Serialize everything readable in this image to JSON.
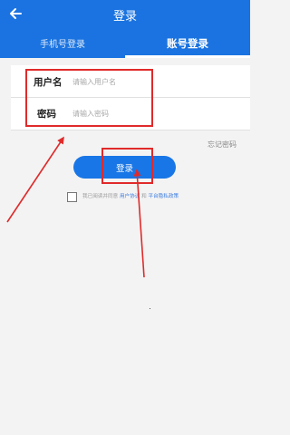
{
  "header": {
    "title": "登录",
    "back_icon": "arrow-left-icon",
    "color": "#1a73e0"
  },
  "tabs": [
    {
      "label": "手机号登录",
      "active": false
    },
    {
      "label": "账号登录",
      "active": true
    }
  ],
  "form": {
    "username": {
      "label": "用户名",
      "placeholder": "请输入用户名",
      "value": ""
    },
    "password": {
      "label": "密码",
      "placeholder": "请输入密码",
      "value": ""
    }
  },
  "forgot_password": "忘记密码",
  "login_button": {
    "label": "登录",
    "color": "#1976e6"
  },
  "agreement": {
    "checked": false,
    "prefix": "我已阅读并同意 ",
    "user_agreement": "用户协议",
    "conjunction": " 和 ",
    "privacy_policy": "平台隐私政策"
  },
  "annotation": {
    "color": "#e02a2a"
  }
}
